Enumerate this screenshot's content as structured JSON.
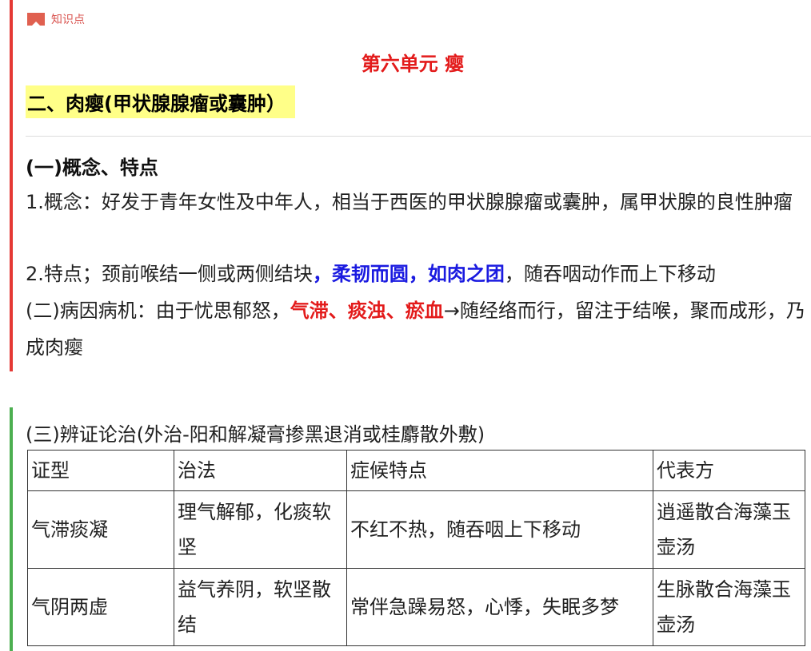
{
  "tag": {
    "icon": "flag-icon",
    "label": "知识点",
    "color": "#e06050"
  },
  "unit_title": "第六单元 瘿",
  "sub_title": "二、肉瘿(甲状腺腺瘤或囊肿）",
  "concept_heading": "(一)概念、特点",
  "p1": "1.概念：好发于青年女性及中年人，相当于西医的甲状腺腺瘤或囊肿，属甲状腺的良性肿瘤",
  "p2": {
    "a": "2.特点；颈前喉结一侧或两侧结块",
    "b": "，柔韧而圆，如肉之团",
    "c": "，随吞咽动作而上下移动"
  },
  "p3": {
    "a": "(二)病因病机：由于忧思郁怒，",
    "b": "气滞、痰浊、瘀血",
    "c": "→随经络而行，留注于结喉，聚而成形，乃成肉瘿"
  },
  "diag_heading": "(三)辨证论治(外治-阳和解凝膏掺黑退消或桂麝散外敷)",
  "table": {
    "headers": [
      "证型",
      "治法",
      "症候特点",
      "代表方"
    ],
    "rows": [
      [
        "气滞痰凝",
        "理气解郁，化痰软坚",
        "不红不热，随吞咽上下移动",
        "逍遥散合海藻玉壶汤"
      ],
      [
        "气阴两虚",
        "益气养阴，软坚散结",
        "常伴急躁易怒，心悸，失眠多梦",
        "生脉散合海藻玉壶汤"
      ]
    ]
  },
  "colors": {
    "red_bar": "#e53935",
    "green_bar": "#4caf50",
    "title_red": "#e31b1b",
    "emphasis_blue": "#1a1ae0",
    "highlight_yellow": "#ffff88"
  }
}
